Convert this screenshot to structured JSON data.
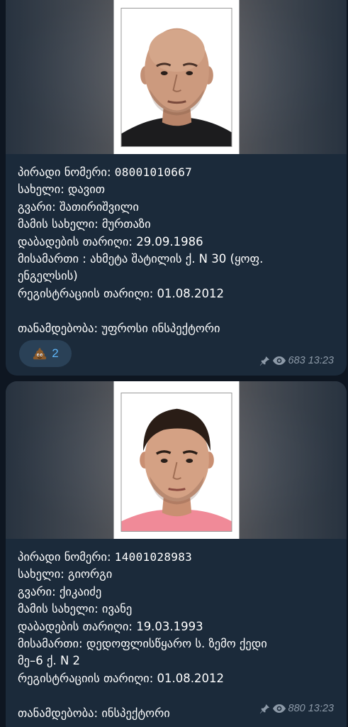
{
  "posts": [
    {
      "person_name_field": "პირადი ნომერი:",
      "id_number": "08001010667",
      "first_name": "სახელი: დავით",
      "last_name": "გვარი: შათირიშვილი",
      "father_name": "მამის სახელი: მურთაზი",
      "birth_date": "დაბადების თარიღი:  29.09.1986",
      "address_line1": "მისამართი : ახმეტა შატილის ქ. N 30 (ყოფ.",
      "address_line2": "ენგელსის)",
      "registration_date": "რეგისტრაციის თარიღი: 01.08.2012",
      "position": "თანამდებობა: უფროსი ინსპექტორი",
      "reaction_emoji": "poop-emoji",
      "reaction_count": "2",
      "views": "683",
      "time": "13:23"
    },
    {
      "person_name_field": "პირადი ნომერი:",
      "id_number": "14001028983",
      "first_name": "სახელი: გიორგი",
      "last_name": "გვარი: ქიკაიძე",
      "father_name": "მამის სახელი: ივანე",
      "birth_date": "დაბადების თარიღი: 19.03.1993",
      "address_line1": "მისამართი: დედოფლისწყარო ს. ზემო ქედი",
      "address_line2": "მე–6 ქ. N 2",
      "registration_date": "რეგისტრაციის თარიღი: 01.08.2012",
      "position": "თანამდებობა: ინსპექტორი",
      "views": "880",
      "time": "13:23"
    }
  ],
  "colors": {
    "background": "#0e1621",
    "bubble": "#1b2a3a",
    "text": "#ffffff",
    "meta": "#8d9aa8",
    "reaction_bg": "#2a4157",
    "reaction_text": "#5eb5f7"
  }
}
